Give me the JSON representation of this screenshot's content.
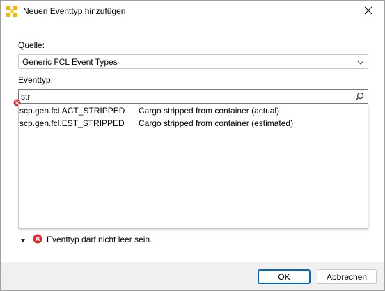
{
  "window": {
    "title": "Neuen Eventtyp hinzufügen",
    "icon": "app-logo-icon",
    "close_icon": "close-icon"
  },
  "source": {
    "label": "Quelle:",
    "selected": "Generic FCL Event Types"
  },
  "eventtype": {
    "label": "Eventtyp:",
    "search_value": "str",
    "results": [
      {
        "code": "scp.gen.fcl.ACT_STRIPPED",
        "description": "Cargo stripped from container (actual)"
      },
      {
        "code": "scp.gen.fcl.EST_STRIPPED",
        "description": "Cargo stripped from container (estimated)"
      }
    ]
  },
  "validation": {
    "message": "Eventtyp darf nicht leer sein.",
    "color": "#e0282e"
  },
  "buttons": {
    "ok": "OK",
    "cancel": "Abbrechen"
  },
  "colors": {
    "accent": "#0067c0",
    "icon_yellow": "#f2b705"
  }
}
